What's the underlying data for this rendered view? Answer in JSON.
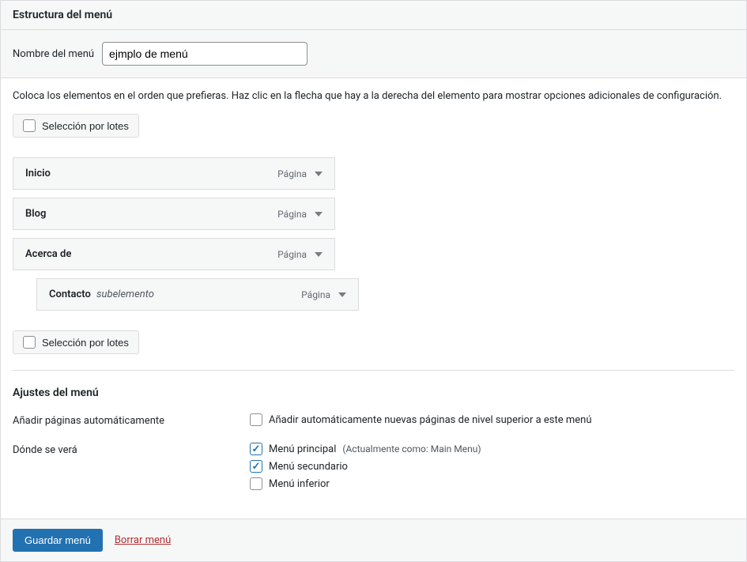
{
  "header": {
    "title": "Estructura del menú"
  },
  "name": {
    "label": "Nombre del menú",
    "value": "ejmplo de menú"
  },
  "instructions": "Coloca los elementos en el orden que prefieras. Haz clic en la flecha que hay a la derecha del elemento para mostrar opciones adicionales de configuración.",
  "batch_select_label": "Selección por lotes",
  "items": [
    {
      "title": "Inicio",
      "type": "Página",
      "sub": false
    },
    {
      "title": "Blog",
      "type": "Página",
      "sub": false
    },
    {
      "title": "Acerca de",
      "type": "Página",
      "sub": false
    },
    {
      "title": "Contacto",
      "type": "Página",
      "sub": true
    }
  ],
  "sub_label": "subelemento",
  "settings": {
    "title": "Ajustes del menú",
    "auto_add": {
      "label": "Añadir páginas automáticamente",
      "option": "Añadir automáticamente nuevas páginas de nivel superior a este menú",
      "checked": false
    },
    "location": {
      "label": "Dónde se verá",
      "options": [
        {
          "label": "Menú principal",
          "hint": "(Actualmente como: Main Menu)",
          "checked": true
        },
        {
          "label": "Menú secundario",
          "hint": "",
          "checked": true
        },
        {
          "label": "Menú inferior",
          "hint": "",
          "checked": false
        }
      ]
    }
  },
  "footer": {
    "save": "Guardar menú",
    "delete": "Borrar menú"
  }
}
